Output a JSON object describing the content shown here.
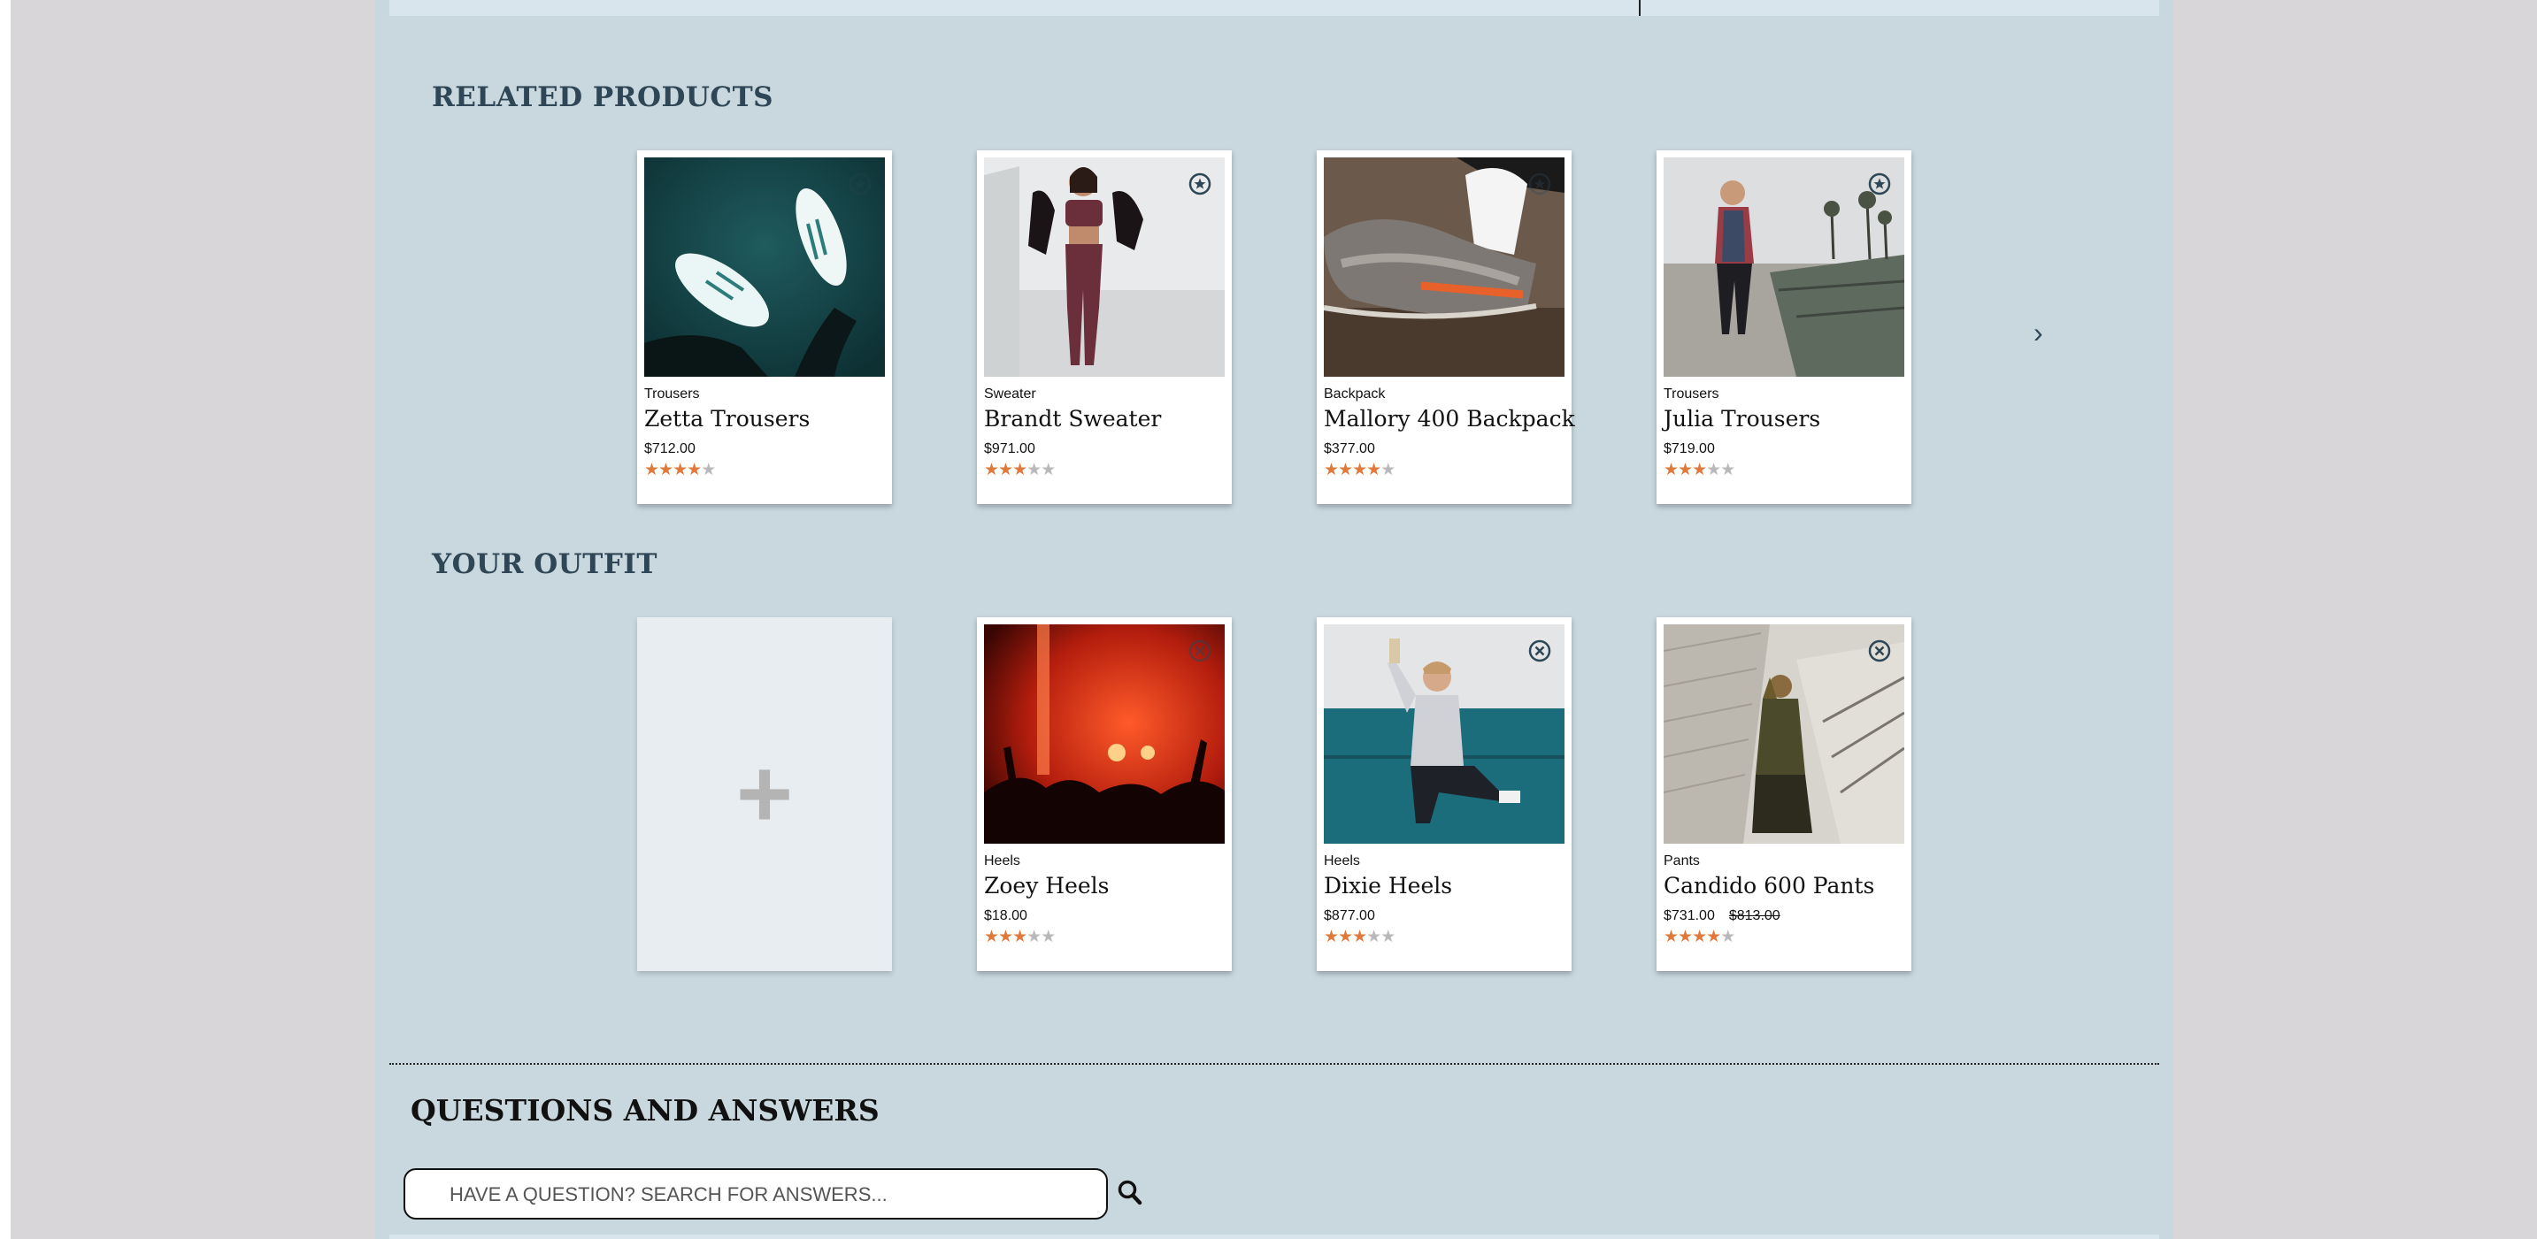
{
  "top_bar": {},
  "related": {
    "heading": "RELATED PRODUCTS",
    "items": [
      {
        "category": "Trousers",
        "name": "Zetta Trousers",
        "price": "$712.00",
        "rating": 4,
        "action_icon": "star-circle-icon"
      },
      {
        "category": "Sweater",
        "name": "Brandt Sweater",
        "price": "$971.00",
        "rating": 3,
        "action_icon": "star-circle-icon"
      },
      {
        "category": "Backpack",
        "name": "Mallory 400 Backpack",
        "price": "$377.00",
        "rating": 3.5,
        "action_icon": "star-circle-icon"
      },
      {
        "category": "Trousers",
        "name": "Julia Trousers",
        "price": "$719.00",
        "rating": 3,
        "action_icon": "star-circle-icon"
      }
    ],
    "next_arrow": "›"
  },
  "outfit": {
    "heading": "YOUR OUTFIT",
    "add_symbol": "+",
    "items": [
      {
        "category": "Heels",
        "name": "Zoey Heels",
        "price": "$18.00",
        "rating": 3,
        "action_icon": "close-circle-icon"
      },
      {
        "category": "Heels",
        "name": "Dixie Heels",
        "price": "$877.00",
        "rating": 3,
        "action_icon": "close-circle-icon"
      },
      {
        "category": "Pants",
        "name": "Candido 600 Pants",
        "price": "$731.00",
        "original_price": "$813.00",
        "rating": 3.5,
        "action_icon": "close-circle-icon"
      }
    ]
  },
  "qa": {
    "heading": "QUESTIONS AND ANSWERS",
    "search_placeholder": "HAVE A QUESTION? SEARCH FOR ANSWERS..."
  },
  "colors": {
    "panel": "#c9d8df",
    "heading": "#2e4655",
    "star_on": "#e07a3a",
    "star_off": "#b9b9b9"
  }
}
